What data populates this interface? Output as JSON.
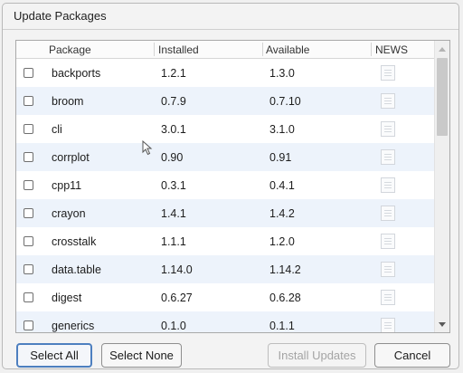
{
  "dialog": {
    "title": "Update Packages"
  },
  "table": {
    "columns": [
      "Package",
      "Installed",
      "Available",
      "NEWS"
    ],
    "rows": [
      {
        "package": "backports",
        "installed": "1.2.1",
        "available": "1.3.0"
      },
      {
        "package": "broom",
        "installed": "0.7.9",
        "available": "0.7.10"
      },
      {
        "package": "cli",
        "installed": "3.0.1",
        "available": "3.1.0"
      },
      {
        "package": "corrplot",
        "installed": "0.90",
        "available": "0.91"
      },
      {
        "package": "cpp11",
        "installed": "0.3.1",
        "available": "0.4.1"
      },
      {
        "package": "crayon",
        "installed": "1.4.1",
        "available": "1.4.2"
      },
      {
        "package": "crosstalk",
        "installed": "1.1.1",
        "available": "1.2.0"
      },
      {
        "package": "data.table",
        "installed": "1.14.0",
        "available": "1.14.2"
      },
      {
        "package": "digest",
        "installed": "0.6.27",
        "available": "0.6.28"
      },
      {
        "package": "generics",
        "installed": "0.1.0",
        "available": "0.1.1"
      }
    ]
  },
  "buttons": {
    "select_all": "Select All",
    "select_none": "Select None",
    "install_updates": "Install Updates",
    "cancel": "Cancel"
  }
}
